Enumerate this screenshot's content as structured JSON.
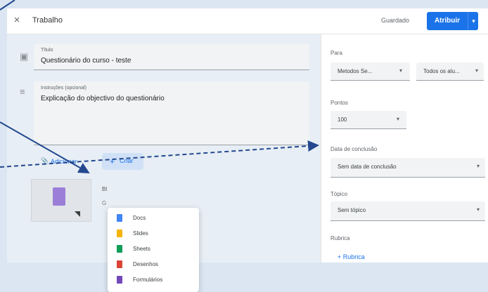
{
  "header": {
    "title": "Trabalho",
    "save_label": "Guardado",
    "assign_label": "Atribuir",
    "assign_caret": "▾",
    "close_icon": "×"
  },
  "fields": {
    "title_label": "Título",
    "title_value": "Questionário do curso - teste",
    "instructions_label": "Instruções (opcional)",
    "instructions_value": "Explicação do objectivo do questionário"
  },
  "toolbar": {
    "add_label": "Adicionar",
    "create_label": "Criar",
    "add_icon": "📎",
    "create_plus": "+"
  },
  "create_menu": {
    "items": [
      {
        "label": "Docs",
        "color": "#4285f4"
      },
      {
        "label": "Slides",
        "color": "#f4b400"
      },
      {
        "label": "Sheets",
        "color": "#0f9d58"
      },
      {
        "label": "Desenhos",
        "color": "#db4437"
      },
      {
        "label": "Formulários",
        "color": "#7248b9"
      }
    ]
  },
  "attachment": {
    "partial_title": "Bl",
    "partial_sub": "G"
  },
  "right_panel": {
    "para_label": "Para",
    "class_value": "Metodos Se...",
    "students_value": "Todos os alu...",
    "points_label": "Pontos",
    "points_value": "100",
    "due_label": "Data de conclusão",
    "due_value": "Sem data de conclusão",
    "topic_label": "Tópico",
    "topic_value": "Sem tópico",
    "rubric_label": "Rubrica",
    "rubric_button": "+ Rubrica"
  },
  "colors": {
    "accent": "#1a73e8",
    "arrow": "#23488f"
  }
}
